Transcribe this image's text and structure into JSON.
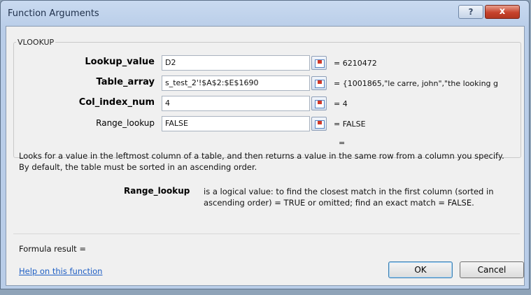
{
  "window": {
    "title": "Function Arguments",
    "help_glyph": "?",
    "close_glyph": "x"
  },
  "function": {
    "name": "VLOOKUP"
  },
  "arguments": [
    {
      "label": "Lookup_value",
      "bold": true,
      "value": "D2",
      "result": "= 6210472"
    },
    {
      "label": "Table_array",
      "bold": true,
      "value": "s_test_2'!$A$2:$E$1690",
      "result": "= {1001865,\"le carre, john\",\"the looking g"
    },
    {
      "label": "Col_index_num",
      "bold": true,
      "value": "4",
      "result": "= 4"
    },
    {
      "label": "Range_lookup",
      "bold": false,
      "value": "FALSE",
      "result": "= FALSE"
    }
  ],
  "overall_result_eq": "=",
  "description": {
    "line1": "Looks for a value in the leftmost column of a table, and then returns a value in the same row from a column you specify.",
    "line2": "By default, the table must be sorted in an ascending order.",
    "arg_name": "Range_lookup",
    "arg_text": "is a logical value: to find the closest match in the first column (sorted in ascending order) = TRUE or omitted; find an exact match = FALSE."
  },
  "formula_result": "Formula result =",
  "help_link": "Help on this function",
  "buttons": {
    "ok": "OK",
    "cancel": "Cancel"
  },
  "colors": {
    "title_bar": "#b9cde8",
    "close_button": "#c7432c",
    "link": "#1f5fc4"
  },
  "icons": {
    "ref_button": "collapse-dialog-icon"
  }
}
